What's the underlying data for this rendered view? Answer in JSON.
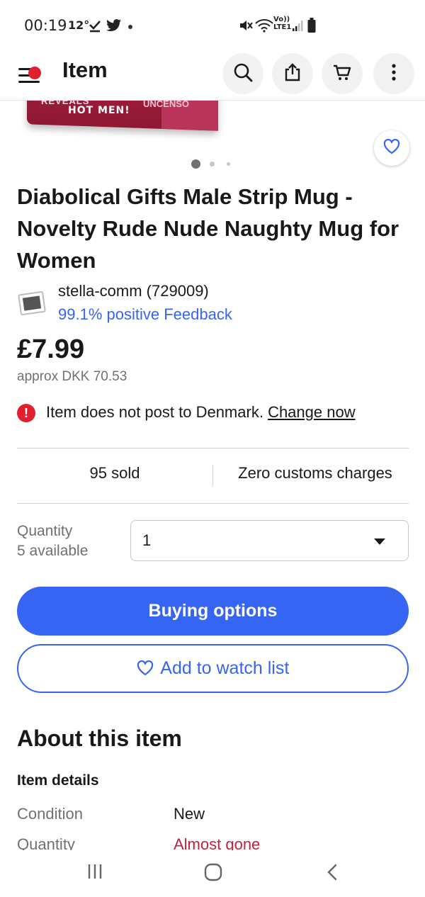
{
  "status_bar": {
    "time": "00:19",
    "temperature": "12°",
    "icons": [
      "check-icon",
      "twitter-icon",
      "dot-icon",
      "mute-icon",
      "wifi-icon",
      "volte-icon",
      "signal-icon",
      "battery-icon"
    ],
    "volte_label": "Vo))",
    "lte_label": "LTE1"
  },
  "header": {
    "title": "Item",
    "buttons": [
      "search-icon",
      "share-icon",
      "cart-icon",
      "more-icon"
    ]
  },
  "hero": {
    "image_text": [
      "REVEALS",
      "HOT MEN!",
      "UNCENSO"
    ],
    "page_dots": 3,
    "active_dot": 1
  },
  "item": {
    "title": "Diabolical Gifts Male Strip Mug - Novelty Rude Nude Naughty Mug for Women",
    "seller_name": "stella-comm (729009)",
    "seller_feedback": "99.1% positive Feedback",
    "price": "£7.99",
    "approx_price": "approx DKK 70.53"
  },
  "alert": {
    "text": "Item does not post to Denmark.",
    "link": "Change now"
  },
  "stats": {
    "sold": "95 sold",
    "customs": "Zero customs charges"
  },
  "quantity": {
    "label": "Quantity",
    "available": "5 available",
    "value": "1"
  },
  "actions": {
    "primary": "Buying options",
    "secondary": "Add to watch list"
  },
  "about": {
    "heading": "About this item",
    "details_heading": "Item details",
    "rows": [
      {
        "label": "Condition",
        "value": "New"
      },
      {
        "label": "Quantity",
        "value": "Almost gone"
      }
    ]
  },
  "colors": {
    "accent": "#3665f3",
    "alert": "#e0202e",
    "urgent_text": "#c0233d"
  }
}
